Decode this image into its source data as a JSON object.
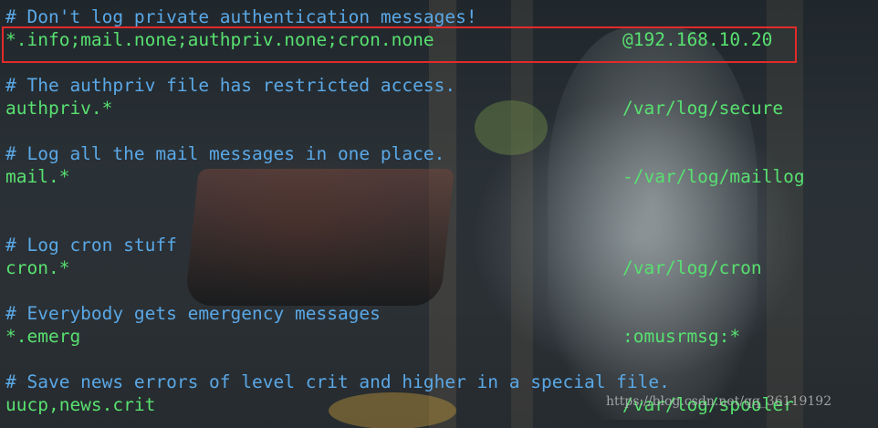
{
  "lines": [
    {
      "type": "comment",
      "text": "# Don't log private authentication messages!"
    },
    {
      "type": "rule",
      "selector": "*.info;mail.none;authpriv.none;cron.none",
      "action": "@192.168.10.20",
      "highlighted": true
    },
    {
      "type": "blank"
    },
    {
      "type": "comment",
      "text": "# The authpriv file has restricted access."
    },
    {
      "type": "rule",
      "selector": "authpriv.*",
      "action": "/var/log/secure"
    },
    {
      "type": "blank"
    },
    {
      "type": "comment",
      "text": "# Log all the mail messages in one place."
    },
    {
      "type": "rule",
      "selector": "mail.*",
      "action": "-/var/log/maillog"
    },
    {
      "type": "blank"
    },
    {
      "type": "blank"
    },
    {
      "type": "comment",
      "text": "# Log cron stuff"
    },
    {
      "type": "rule",
      "selector": "cron.*",
      "action": "/var/log/cron"
    },
    {
      "type": "blank"
    },
    {
      "type": "comment",
      "text": "# Everybody gets emergency messages"
    },
    {
      "type": "rule",
      "selector": "*.emerg",
      "action": ":omusrmsg:*"
    },
    {
      "type": "blank"
    },
    {
      "type": "comment",
      "text": "# Save news errors of level crit and higher in a special file."
    },
    {
      "type": "rule",
      "selector": "uucp,news.crit",
      "action": "/var/log/spooler"
    }
  ],
  "watermark": "https://blog.csdn.net/qq_36119192",
  "colors": {
    "comment": "#5aa8e6",
    "code": "#58e070",
    "highlight_border": "#e32a2a"
  }
}
